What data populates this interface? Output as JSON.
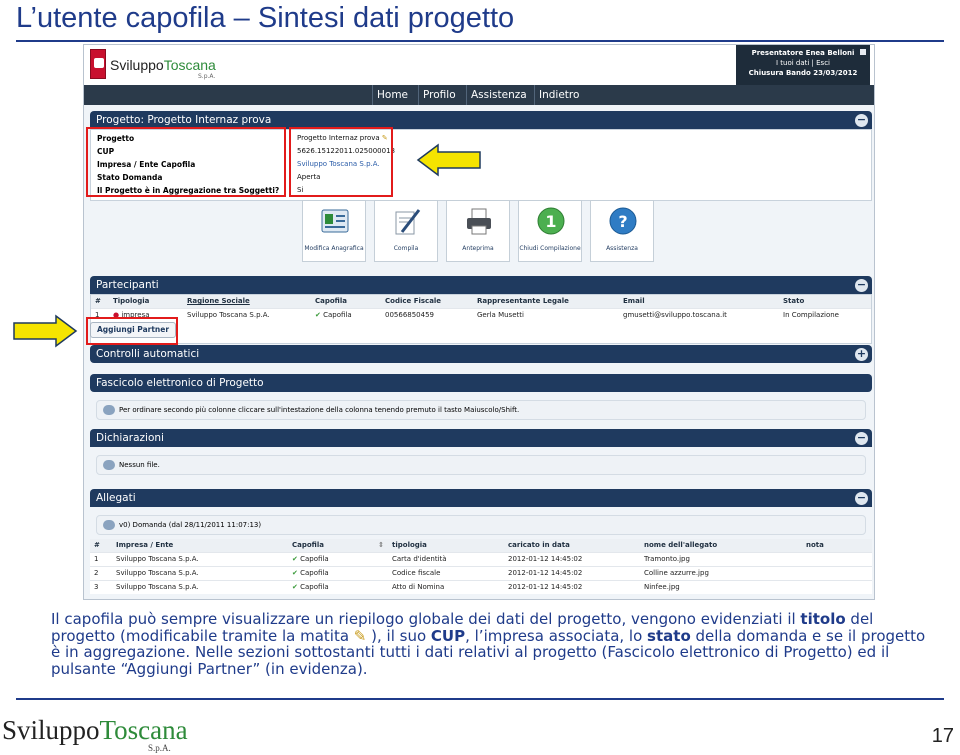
{
  "slide": {
    "title": "L’utente capofila – Sintesi dati progetto",
    "page_number": "17",
    "footer_logo_a": "Sviluppo",
    "footer_logo_b": "Toscana",
    "footer_logo_spa": "S.p.A."
  },
  "app": {
    "logo_region": "REGIONE TOSCANA",
    "logo_a": "Sviluppo",
    "logo_b": "Toscana",
    "logo_spa": "S.p.A.",
    "user_line1": "Presentatore Enea Belloni",
    "user_line2": "I tuoi dati | Esci",
    "user_line3": "Chiusura Bando 23/03/2012",
    "nav": [
      "Home",
      "Profilo",
      "Assistenza",
      "Indietro"
    ]
  },
  "summary": {
    "header": "Progetto: Progetto Internaz prova",
    "rows": [
      {
        "label": "Progetto",
        "value": "Progetto Internaz prova"
      },
      {
        "label": "CUP",
        "value": "5626.15122011.025000018"
      },
      {
        "label": "Impresa / Ente Capofila",
        "value": "Sviluppo Toscana S.p.A."
      },
      {
        "label": "Stato Domanda",
        "value": "Aperta"
      },
      {
        "label": "Il Progetto è in Aggregazione tra Soggetti?",
        "value": "Si"
      }
    ]
  },
  "tiles": [
    {
      "label": "Modifica Anagrafica",
      "icon": "id-card-icon"
    },
    {
      "label": "Compila",
      "icon": "pen-paper-icon"
    },
    {
      "label": "Anteprima",
      "icon": "printer-icon"
    },
    {
      "label": "Chiudi Compilazione",
      "icon": "number-one-icon"
    },
    {
      "label": "Assistenza",
      "icon": "help-icon"
    }
  ],
  "partecipanti": {
    "header": "Partecipanti",
    "columns": [
      "#",
      "Tipologia",
      "Ragione Sociale",
      "Capofila",
      "Codice Fiscale",
      "Rappresentante Legale",
      "Email",
      "Stato"
    ],
    "rows": [
      [
        "1",
        "impresa",
        "Sviluppo Toscana S.p.A.",
        "Capofila",
        "00566850459",
        "Gerla Musetti",
        "gmusetti@sviluppo.toscana.it",
        "In Compilazione"
      ]
    ],
    "add_button": "Aggiungi Partner"
  },
  "controlli": {
    "header": "Controlli automatici"
  },
  "fascicolo": {
    "header": "Fascicolo elettronico di Progetto",
    "info": "Per ordinare secondo più colonne cliccare sull'intestazione della colonna tenendo premuto il tasto Maiuscolo/Shift."
  },
  "dichiarazioni": {
    "header": "Dichiarazioni",
    "info": "Nessun file."
  },
  "allegati": {
    "header": "Allegati",
    "info": "v0) Domanda (dal 28/11/2011 11:07:13)",
    "columns": [
      "#",
      "Impresa / Ente",
      "Capofila",
      "tipologia",
      "caricato in data",
      "nome dell'allegato",
      "nota"
    ],
    "rows": [
      [
        "1",
        "Sviluppo Toscana S.p.A.",
        "Capofila",
        "Carta d'identità",
        "2012-01-12 14:45:02",
        "Tramonto.jpg",
        ""
      ],
      [
        "2",
        "Sviluppo Toscana S.p.A.",
        "Capofila",
        "Codice fiscale",
        "2012-01-12 14:45:02",
        "Colline azzurre.jpg",
        ""
      ],
      [
        "3",
        "Sviluppo Toscana S.p.A.",
        "Capofila",
        "Atto di Nomina",
        "2012-01-12 14:45:02",
        "Ninfee.jpg",
        ""
      ]
    ]
  },
  "description": {
    "p1": "Il capofila può sempre visualizzare un riepilogo globale dei dati del progetto, vengono evidenziati il ",
    "b1": "titolo",
    "p2": " del progetto (modificabile tramite la matita ",
    "p3": " ), il suo ",
    "b2": "CUP",
    "p4": ", l’impresa associata, lo ",
    "b3": "stato",
    "p5": " della domanda e se il progetto è in aggregazione. Nelle sezioni sottostanti tutti i dati relativi al progetto (Fascicolo elettronico di Progetto) ed il pulsante “Aggiungi Partner” (in evidenza)."
  },
  "colors": {
    "accent": "#1f3b8a",
    "header_blue": "#1f3a5f",
    "highlight": "#e21b1b",
    "arrow": "#f5e400"
  }
}
